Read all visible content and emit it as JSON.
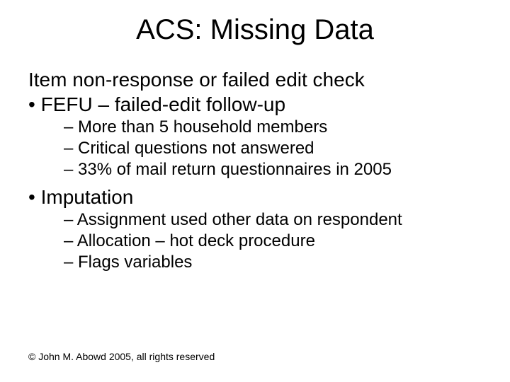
{
  "title": "ACS: Missing Data",
  "lines": {
    "item_nonresponse": "Item non-response or failed edit check",
    "fefu": "FEFU – failed-edit follow-up",
    "fefu_sub1": "More than 5 household members",
    "fefu_sub2": "Critical questions not answered",
    "fefu_sub3": "33% of mail return questionnaires in 2005",
    "imputation": "Imputation",
    "imp_sub1": "Assignment used other data on respondent",
    "imp_sub2": "Allocation – hot deck procedure",
    "imp_sub3": "Flags variables"
  },
  "footer": "© John M. Abowd 2005, all rights reserved"
}
